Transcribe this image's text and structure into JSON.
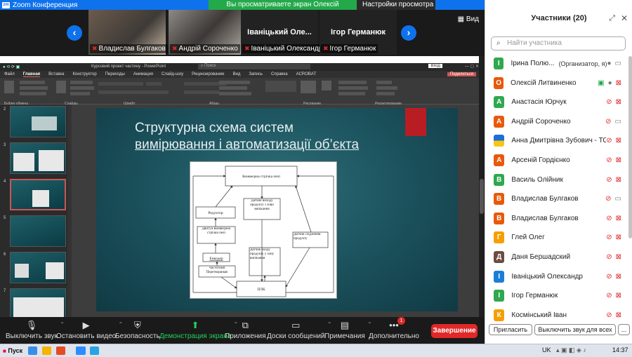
{
  "window": {
    "title": "Zoom Конференция"
  },
  "share_banner": {
    "text": "Вы просматриваете экран Олексій Литвиненко",
    "options": "Настройки просмотра"
  },
  "gallery": {
    "view_label": "Вид",
    "tiles": [
      {
        "name": "Владислав Булгаков",
        "kind": "video"
      },
      {
        "name": "Андрій Сороченко",
        "kind": "video"
      },
      {
        "name": "Іваніцький Олександр",
        "big": "Іваніцький  Оле...",
        "kind": "name"
      },
      {
        "name": "Ігор Германюк",
        "big": "Ігор Германюк",
        "kind": "name"
      }
    ]
  },
  "powerpoint": {
    "doc_title": "Курсовий проект частину  -  PowerPoint",
    "search": "Поиск",
    "sign_in": "Вход",
    "share": "Поделиться",
    "tabs": [
      "Файл",
      "Главная",
      "Вставка",
      "Конструктор",
      "Переходы",
      "Анимация",
      "Слайд-шоу",
      "Рецензирование",
      "Вид",
      "Запись",
      "Справка",
      "ACROBAT"
    ],
    "groups": [
      "Буфер обмена",
      "Слайды",
      "Шрифт",
      "Абзац",
      "Рисование",
      "Редактирование"
    ],
    "slide_numbers": [
      "2",
      "3",
      "4",
      "5",
      "6",
      "7"
    ],
    "slide": {
      "title_line1": "Структурна схема систем",
      "title_line2": "вимірювання і автоматизації об’єкта"
    },
    "diagram": {
      "conveyor": "Конвеєрна стрічка печі",
      "reducer": "Редуктор",
      "exit_sensor": "Датчик виходу продукту з зови випікання",
      "motor": "Двигун Конвеєрної стрічки печі",
      "encoder": "Енкодер",
      "entry_sensor": "Датчик входу продукту у зону випікання",
      "tracking_sensor": "Датчик слідження продукту",
      "inverter": "Частотний Перетворювач",
      "plc": "ПЛК"
    }
  },
  "toolbar": {
    "items": [
      "Выключить звук",
      "Остановить видео",
      "Безопасность",
      "Демонстрация экрана",
      "Приложения",
      "Доски сообщений",
      "Примечания",
      "Дополнительно"
    ],
    "more_badge": "1",
    "end": "Завершение"
  },
  "participants": {
    "title": "Участники (20)",
    "search_placeholder": "Найти участника",
    "list": [
      {
        "initial": "І",
        "color": "#2fa84f",
        "name": "Ірина Полю...",
        "note": "(Организатор, я)",
        "mic": "on",
        "video": "on"
      },
      {
        "initial": "О",
        "color": "#e8590c",
        "name": "Олексій Литвиненко",
        "share": true,
        "mic": "on",
        "video": "off"
      },
      {
        "initial": "А",
        "color": "#2fa84f",
        "name": "Анастасія Юрчук",
        "mic": "off",
        "video": "off"
      },
      {
        "initial": "А",
        "color": "#e8590c",
        "name": "Андрій Сороченко",
        "mic": "off",
        "video": "on"
      },
      {
        "initial": "",
        "color": "#f5c518",
        "name": "Анна Дмитрівна Зубович - ТО...",
        "mic": "off",
        "video": "off"
      },
      {
        "initial": "А",
        "color": "#e8590c",
        "name": "Арсеній Гордієнко",
        "mic": "off",
        "video": "off"
      },
      {
        "initial": "В",
        "color": "#2fa84f",
        "name": "Василь Олійник",
        "mic": "off",
        "video": "off"
      },
      {
        "initial": "В",
        "color": "#e8590c",
        "name": "Владислав Булгаков",
        "mic": "off",
        "video": "on"
      },
      {
        "initial": "В",
        "color": "#e8590c",
        "name": "Владислав Булгаков",
        "mic": "off",
        "video": "off"
      },
      {
        "initial": "Г",
        "color": "#f59f00",
        "name": "Глей Олег",
        "mic": "off",
        "video": "off"
      },
      {
        "initial": "Д",
        "color": "#6d4c41",
        "name": "Даня Бершадский",
        "mic": "off",
        "video": "off"
      },
      {
        "initial": "І",
        "color": "#1c7ed6",
        "name": "Іваніцький Олександр",
        "mic": "off",
        "video": "off"
      },
      {
        "initial": "І",
        "color": "#2fa84f",
        "name": "Ігор Германюк",
        "mic": "off",
        "video": "off"
      },
      {
        "initial": "К",
        "color": "#f59f00",
        "name": "Космінський Іван",
        "mic": "off",
        "video": "off"
      }
    ],
    "invite": "Пригласить",
    "mute_all": "Выключить звук для всех",
    "more": "..."
  },
  "taskbar": {
    "start": "Пуск",
    "lang": "UK",
    "time": "14:37"
  }
}
